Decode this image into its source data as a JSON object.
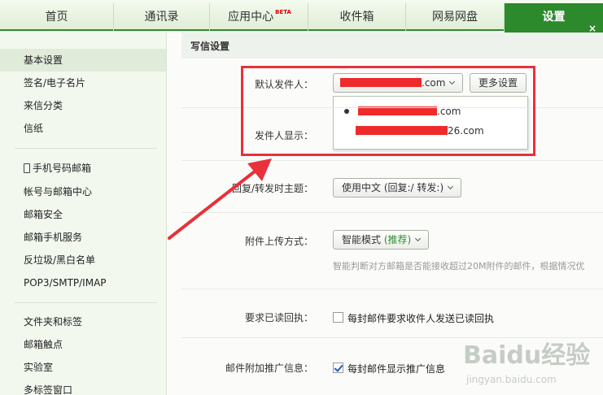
{
  "top_tabs": [
    {
      "label": "首页"
    },
    {
      "label": "通讯录"
    },
    {
      "label": "应用中心",
      "badge": "BETA"
    },
    {
      "label": "收件箱"
    },
    {
      "label": "网易网盘"
    },
    {
      "label": "设置"
    }
  ],
  "close_glyph": "×",
  "sidebar": {
    "group1": [
      "基本设置",
      "签名/电子名片",
      "来信分类",
      "信纸"
    ],
    "group2": [
      "手机号码邮箱",
      "帐号与邮箱中心",
      "邮箱安全",
      "邮箱手机服务",
      "反垃圾/黑白名单",
      "POP3/SMTP/IMAP"
    ],
    "group3": [
      "文件夹和标签",
      "邮箱触点",
      "实验室",
      "多标签窗口"
    ]
  },
  "main": {
    "section_title": "写信设置",
    "default_sender": {
      "label": "默认发件人：",
      "value_suffix": ".com",
      "more_button": "更多设置",
      "options": [
        ".com",
        "26.com"
      ]
    },
    "sender_display": {
      "label": "发件人显示："
    },
    "reply_subject": {
      "label": "回复/转发时主题：",
      "value": "使用中文 (回复:/ 转发:)"
    },
    "attachment_upload": {
      "label": "附件上传方式：",
      "value_prefix": "智能模式",
      "value_highlight": "(推荐)",
      "hint": "智能判断对方邮箱是否能接收超过20M附件的邮件，根据情况优"
    },
    "read_receipt": {
      "label": "要求已读回执：",
      "checkbox_label": "每封邮件要求收件人发送已读回执",
      "checked": false
    },
    "promo_info": {
      "label": "邮件附加推广信息：",
      "checkbox_label": "每封邮件显示推广信息",
      "checked": true
    }
  },
  "watermark": {
    "text": "Baidu经验",
    "url": "jingyan.baidu.com"
  },
  "colors": {
    "accent_green": "#2c8a2c",
    "annotation_red": "#e8313a",
    "redaction_red": "#ee2a2a"
  }
}
